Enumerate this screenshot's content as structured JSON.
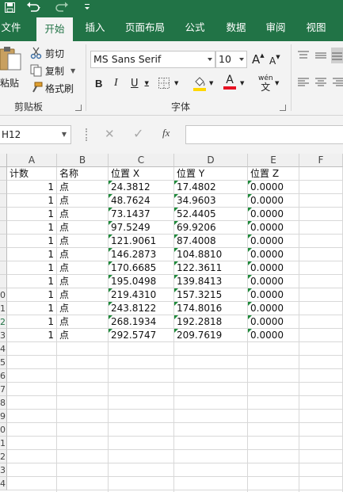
{
  "quick_access": {
    "save_icon": "save-icon",
    "undo_icon": "undo-icon",
    "redo_icon": "redo-icon",
    "customize_icon": "customize-qat-icon"
  },
  "tabs": [
    "文件",
    "开始",
    "插入",
    "页面布局",
    "公式",
    "数据",
    "审阅",
    "视图"
  ],
  "active_tab": "开始",
  "clipboard": {
    "paste_label": "粘贴",
    "cut_label": "剪切",
    "copy_label": "复制",
    "format_painter_label": "格式刷",
    "group_label": "剪贴板"
  },
  "font": {
    "font_name": "MS Sans Serif",
    "font_size": "10",
    "grow_label": "A",
    "shrink_label": "A",
    "bold_label": "B",
    "italic_label": "I",
    "underline_label": "U",
    "phonetic_label": "wén",
    "group_label": "字体",
    "fill_color": "#ffd700",
    "font_color": "#e81123"
  },
  "formula_bar": {
    "name_box": "H12",
    "cancel_symbol": "✕",
    "enter_symbol": "✓",
    "fx_label": "fx",
    "content": ""
  },
  "grid": {
    "columns": [
      "A",
      "B",
      "C",
      "D",
      "E",
      "F"
    ],
    "row_numbers": [
      "",
      "",
      "",
      "",
      "",
      "",
      "",
      "",
      "",
      "0",
      "1",
      "2",
      "3",
      "4",
      "5",
      "6",
      "7",
      "8",
      "9",
      "0",
      "1",
      "2",
      "3",
      "4"
    ],
    "headers": [
      "计数",
      "名称",
      "位置 X",
      "位置 Y",
      "位置 Z"
    ],
    "rows": [
      [
        "1",
        "点",
        "24.3812",
        "17.4802",
        "0.0000"
      ],
      [
        "1",
        "点",
        "48.7624",
        "34.9603",
        "0.0000"
      ],
      [
        "1",
        "点",
        "73.1437",
        "52.4405",
        "0.0000"
      ],
      [
        "1",
        "点",
        "97.5249",
        "69.9206",
        "0.0000"
      ],
      [
        "1",
        "点",
        "121.9061",
        "87.4008",
        "0.0000"
      ],
      [
        "1",
        "点",
        "146.2873",
        "104.8810",
        "0.0000"
      ],
      [
        "1",
        "点",
        "170.6685",
        "122.3611",
        "0.0000"
      ],
      [
        "1",
        "点",
        "195.0498",
        "139.8413",
        "0.0000"
      ],
      [
        "1",
        "点",
        "219.4310",
        "157.3215",
        "0.0000"
      ],
      [
        "1",
        "点",
        "243.8122",
        "174.8016",
        "0.0000"
      ],
      [
        "1",
        "点",
        "268.1934",
        "192.2818",
        "0.0000"
      ],
      [
        "1",
        "点",
        "292.5747",
        "209.7619",
        "0.0000"
      ]
    ],
    "error_flag_color": "#1e8a3a",
    "selected_row_header_color": "#217346"
  }
}
